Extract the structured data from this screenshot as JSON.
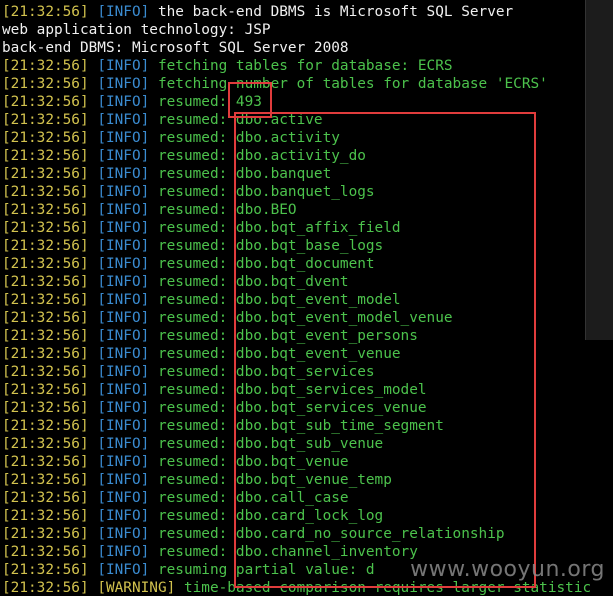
{
  "lines": [
    {
      "ts": "[21:32:56]",
      "level": "[INFO]",
      "level_type": "info",
      "msg": " the back-end DBMS is Microsoft SQL Server",
      "msg_style": "white"
    },
    {
      "ts": "",
      "level": "",
      "level_type": "",
      "msg": "web application technology: JSP",
      "msg_style": "white"
    },
    {
      "ts": "",
      "level": "",
      "level_type": "",
      "msg": "back-end DBMS: Microsoft SQL Server 2008",
      "msg_style": "white"
    },
    {
      "ts": "[21:32:56]",
      "level": "[INFO]",
      "level_type": "info",
      "msg": " fetching tables for database: ECRS",
      "msg_style": "green"
    },
    {
      "ts": "[21:32:56]",
      "level": "[INFO]",
      "level_type": "info",
      "msg": " fetching number of tables for database 'ECRS'",
      "msg_style": "green"
    },
    {
      "ts": "[21:32:56]",
      "level": "[INFO]",
      "level_type": "info",
      "msg": " resumed: 493",
      "msg_style": "green"
    },
    {
      "ts": "[21:32:56]",
      "level": "[INFO]",
      "level_type": "info",
      "msg": " resumed: dbo.active",
      "msg_style": "green"
    },
    {
      "ts": "[21:32:56]",
      "level": "[INFO]",
      "level_type": "info",
      "msg": " resumed: dbo.activity",
      "msg_style": "green"
    },
    {
      "ts": "[21:32:56]",
      "level": "[INFO]",
      "level_type": "info",
      "msg": " resumed: dbo.activity_do",
      "msg_style": "green"
    },
    {
      "ts": "[21:32:56]",
      "level": "[INFO]",
      "level_type": "info",
      "msg": " resumed: dbo.banquet",
      "msg_style": "green"
    },
    {
      "ts": "[21:32:56]",
      "level": "[INFO]",
      "level_type": "info",
      "msg": " resumed: dbo.banquet_logs",
      "msg_style": "green"
    },
    {
      "ts": "[21:32:56]",
      "level": "[INFO]",
      "level_type": "info",
      "msg": " resumed: dbo.BEO",
      "msg_style": "green"
    },
    {
      "ts": "[21:32:56]",
      "level": "[INFO]",
      "level_type": "info",
      "msg": " resumed: dbo.bqt_affix_field",
      "msg_style": "green"
    },
    {
      "ts": "[21:32:56]",
      "level": "[INFO]",
      "level_type": "info",
      "msg": " resumed: dbo.bqt_base_logs",
      "msg_style": "green"
    },
    {
      "ts": "[21:32:56]",
      "level": "[INFO]",
      "level_type": "info",
      "msg": " resumed: dbo.bqt_document",
      "msg_style": "green"
    },
    {
      "ts": "[21:32:56]",
      "level": "[INFO]",
      "level_type": "info",
      "msg": " resumed: dbo.bqt_dvent",
      "msg_style": "green"
    },
    {
      "ts": "[21:32:56]",
      "level": "[INFO]",
      "level_type": "info",
      "msg": " resumed: dbo.bqt_event_model",
      "msg_style": "green"
    },
    {
      "ts": "[21:32:56]",
      "level": "[INFO]",
      "level_type": "info",
      "msg": " resumed: dbo.bqt_event_model_venue",
      "msg_style": "green"
    },
    {
      "ts": "[21:32:56]",
      "level": "[INFO]",
      "level_type": "info",
      "msg": " resumed: dbo.bqt_event_persons",
      "msg_style": "green"
    },
    {
      "ts": "[21:32:56]",
      "level": "[INFO]",
      "level_type": "info",
      "msg": " resumed: dbo.bqt_event_venue",
      "msg_style": "green"
    },
    {
      "ts": "[21:32:56]",
      "level": "[INFO]",
      "level_type": "info",
      "msg": " resumed: dbo.bqt_services",
      "msg_style": "green"
    },
    {
      "ts": "[21:32:56]",
      "level": "[INFO]",
      "level_type": "info",
      "msg": " resumed: dbo.bqt_services_model",
      "msg_style": "green"
    },
    {
      "ts": "[21:32:56]",
      "level": "[INFO]",
      "level_type": "info",
      "msg": " resumed: dbo.bqt_services_venue",
      "msg_style": "green"
    },
    {
      "ts": "[21:32:56]",
      "level": "[INFO]",
      "level_type": "info",
      "msg": " resumed: dbo.bqt_sub_time_segment",
      "msg_style": "green"
    },
    {
      "ts": "[21:32:56]",
      "level": "[INFO]",
      "level_type": "info",
      "msg": " resumed: dbo.bqt_sub_venue",
      "msg_style": "green"
    },
    {
      "ts": "[21:32:56]",
      "level": "[INFO]",
      "level_type": "info",
      "msg": " resumed: dbo.bqt_venue",
      "msg_style": "green"
    },
    {
      "ts": "[21:32:56]",
      "level": "[INFO]",
      "level_type": "info",
      "msg": " resumed: dbo.bqt_venue_temp",
      "msg_style": "green"
    },
    {
      "ts": "[21:32:56]",
      "level": "[INFO]",
      "level_type": "info",
      "msg": " resumed: dbo.call_case",
      "msg_style": "green"
    },
    {
      "ts": "[21:32:56]",
      "level": "[INFO]",
      "level_type": "info",
      "msg": " resumed: dbo.card_lock_log",
      "msg_style": "green"
    },
    {
      "ts": "[21:32:56]",
      "level": "[INFO]",
      "level_type": "info",
      "msg": " resumed: dbo.card_no_source_relationship",
      "msg_style": "green"
    },
    {
      "ts": "[21:32:56]",
      "level": "[INFO]",
      "level_type": "info",
      "msg": " resumed: dbo.channel_inventory",
      "msg_style": "green"
    },
    {
      "ts": "[21:32:56]",
      "level": "[INFO]",
      "level_type": "info",
      "msg": " resuming partial value: d",
      "msg_style": "green"
    },
    {
      "ts": "[21:32:56]",
      "level": "[WARNING]",
      "level_type": "warn",
      "msg": " time-based comparison requires larger statistic",
      "msg_style": "green"
    }
  ],
  "watermark": "www.wooyun.org",
  "colors": {
    "background": "#000000",
    "timestamp": "#d2c24e",
    "info": "#3a8bd0",
    "warning": "#d2c24e",
    "message": "#3fae3f",
    "highlight_box": "#e03c3c"
  }
}
